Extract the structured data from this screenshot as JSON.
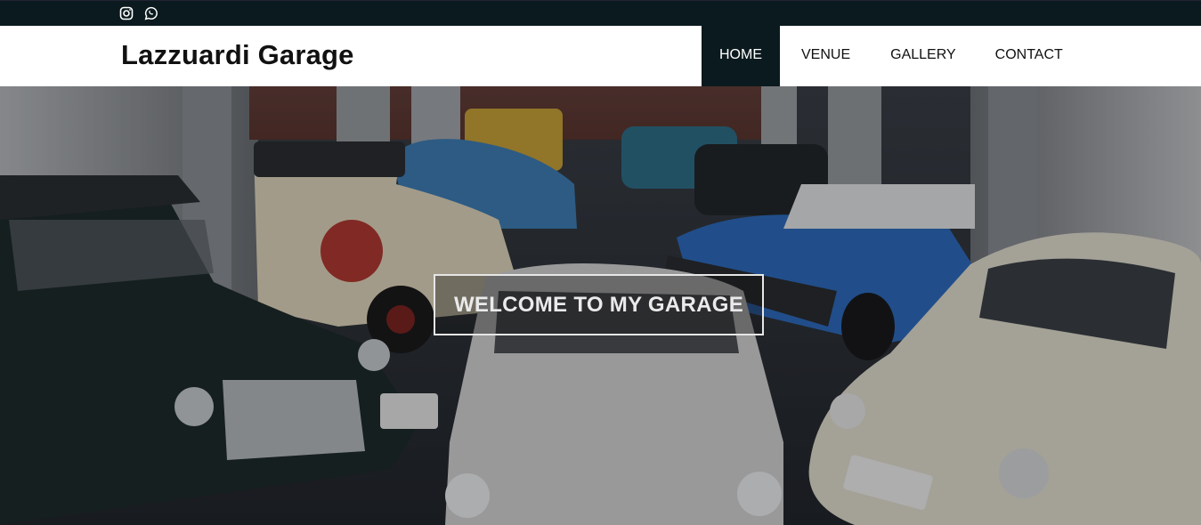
{
  "topbar": {
    "social": [
      {
        "name": "instagram-icon"
      },
      {
        "name": "whatsapp-icon"
      }
    ]
  },
  "nav": {
    "brand": "Lazzuardi Garage",
    "items": [
      {
        "label": "HOME",
        "active": true
      },
      {
        "label": "VENUE",
        "active": false
      },
      {
        "label": "GALLERY",
        "active": false
      },
      {
        "label": "CONTACT",
        "active": false
      }
    ]
  },
  "hero": {
    "heading": "WELCOME TO MY GARAGE"
  },
  "colors": {
    "dark": "#0b1a1e",
    "nav_bg": "#ffffff",
    "text": "#111111"
  }
}
